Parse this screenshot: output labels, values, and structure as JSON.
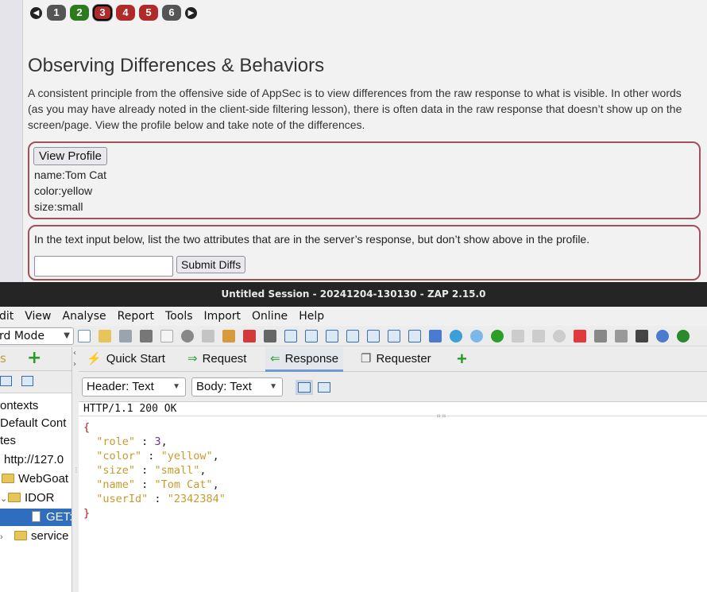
{
  "webgoat": {
    "pager": {
      "prev_icon": "arrow-left-icon",
      "next_icon": "arrow-right-icon",
      "pages": [
        {
          "label": "1",
          "state": "grey"
        },
        {
          "label": "2",
          "state": "green"
        },
        {
          "label": "3",
          "state": "current"
        },
        {
          "label": "4",
          "state": "red"
        },
        {
          "label": "5",
          "state": "red"
        },
        {
          "label": "6",
          "state": "grey"
        }
      ]
    },
    "title": "Observing Differences & Behaviors",
    "description": "A consistent principle from the offensive side of AppSec is to view differences from the raw response to what is visible. In other words (as you may have already noted in the client-side filtering lesson), there is often data in the raw response that doesn’t show up on the screen/page. View the profile below and take note of the differences.",
    "profile_box": {
      "button_label": "View Profile",
      "lines": [
        "name:Tom Cat",
        "color:yellow",
        "size:small"
      ]
    },
    "diff_box": {
      "instruction": "In the text input below, list the two attributes that are in the server’s response, but don’t show above in the profile.",
      "input_value": "",
      "submit_label": "Submit Diffs"
    },
    "colors": {
      "accent_border": "#a0525a",
      "completed": "#2d7a1f",
      "incomplete": "#b02a2a"
    }
  },
  "zap": {
    "window_title": "Untitled Session - 20241204-130130 - ZAP 2.15.0",
    "menu": [
      "dit",
      "View",
      "Analyse",
      "Report",
      "Tools",
      "Import",
      "Online",
      "Help"
    ],
    "mode_select": "rd Mode",
    "tree": {
      "tab_label": "s",
      "items": [
        "ontexts",
        "Default Cont",
        "tes",
        "http://127.0",
        "WebGoat",
        "IDOR",
        "GET:",
        "service"
      ]
    },
    "tabs": [
      {
        "label": "Quick Start",
        "icon": "lightning-icon"
      },
      {
        "label": "Request",
        "icon": "arrow-right-icon"
      },
      {
        "label": "Response",
        "icon": "arrow-left-icon"
      },
      {
        "label": "Requester",
        "icon": "requester-icon"
      }
    ],
    "header_select": "Header: Text",
    "body_select": "Body: Text",
    "status_line": "HTTP/1.1 200 OK",
    "json_body": {
      "open": "{",
      "close": "}",
      "pairs": [
        {
          "key": "\"role\"",
          "value": "3",
          "comma": ","
        },
        {
          "key": "\"color\"",
          "value": "\"yellow\"",
          "comma": ","
        },
        {
          "key": "\"size\"",
          "value": "\"small\"",
          "comma": ","
        },
        {
          "key": "\"name\"",
          "value": "\"Tom Cat\"",
          "comma": ","
        },
        {
          "key": "\"userId\"",
          "value": "\"2342384\"",
          "comma": ""
        }
      ]
    }
  }
}
